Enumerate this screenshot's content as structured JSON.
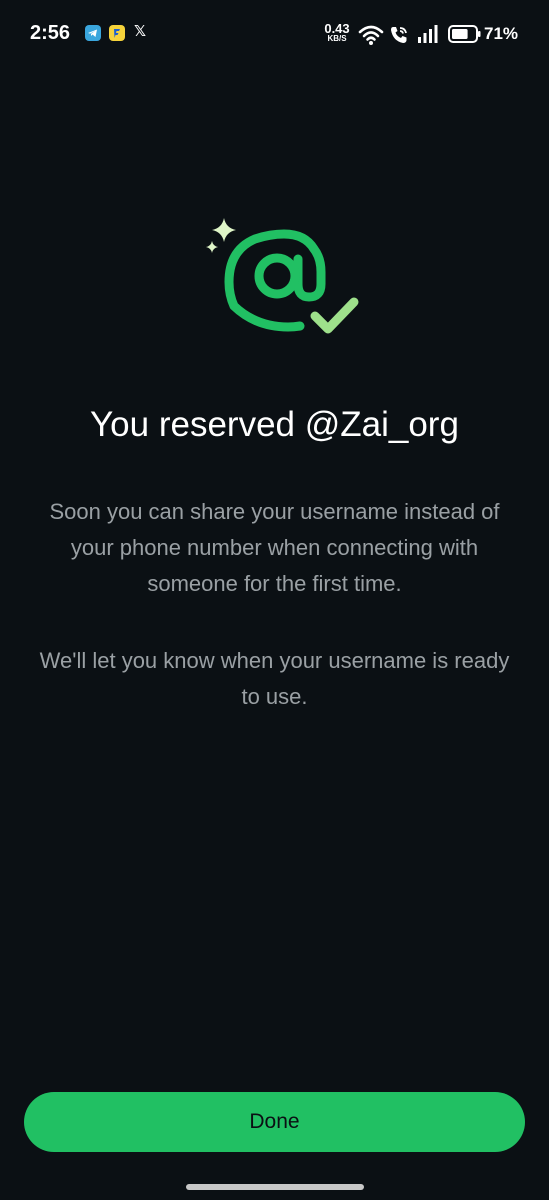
{
  "status_bar": {
    "time": "2:56",
    "x_label": "𝕏",
    "speed_value": "0.43",
    "speed_unit": "KB/S",
    "battery_percent": "71%",
    "battery_level": 0.71
  },
  "icons": {
    "telegram": "telegram-app-icon",
    "flipkart": "flipkart-app-icon",
    "wifi": "wifi-icon",
    "call": "wifi-call-icon",
    "signal": "signal-icon",
    "battery": "battery-icon",
    "illustration": "username-reserved-icon"
  },
  "colors": {
    "background": "#0b1014",
    "accent": "#21c063",
    "check": "#9ee08b"
  },
  "content": {
    "title": "You reserved @Zai_org",
    "paragraph_1": "Soon you can share your username instead of your phone number when connecting with someone for the first time.",
    "paragraph_2": "We'll let you know when your username is ready to use."
  },
  "actions": {
    "done_label": "Done"
  }
}
